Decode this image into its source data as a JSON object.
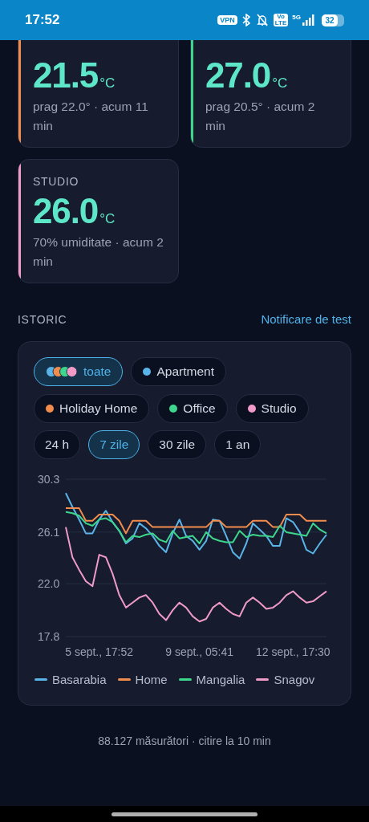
{
  "status_bar": {
    "time": "17:52",
    "vpn": "VPN",
    "volte": [
      "Vo",
      "LTE"
    ],
    "network": "5G",
    "battery": "32"
  },
  "sensor_cards": [
    {
      "value": "21.5",
      "unit": "°C",
      "detail": "prag 22.0° · acum 11 min",
      "color": "#f28c4c"
    },
    {
      "value": "27.0",
      "unit": "°C",
      "detail": "prag 20.5° · acum 2 min",
      "color": "#3dd68c"
    },
    {
      "label": "STUDIO",
      "value": "26.0",
      "unit": "°C",
      "detail": "70% umiditate · acum 2 min",
      "color": "#f09ac8"
    }
  ],
  "history": {
    "title": "ISTORIC",
    "action": "Notificare de test",
    "sensor_filters": [
      {
        "label": "toate",
        "kind": "all",
        "selected": true
      },
      {
        "label": "Apartment",
        "kind": "single",
        "color": "#5ab4e8",
        "selected": false
      },
      {
        "label": "Holiday Home",
        "kind": "single",
        "color": "#f28c4c",
        "selected": false
      },
      {
        "label": "Office",
        "kind": "single",
        "color": "#3dd68c",
        "selected": false
      },
      {
        "label": "Studio",
        "kind": "single",
        "color": "#f09ac8",
        "selected": false
      }
    ],
    "ranges": [
      {
        "label": "24 h",
        "selected": false
      },
      {
        "label": "7 zile",
        "selected": true
      },
      {
        "label": "30 zile",
        "selected": false
      },
      {
        "label": "1 an",
        "selected": false
      }
    ],
    "chart_data": {
      "type": "line",
      "categories": [
        null,
        null,
        null,
        null,
        null,
        "5 sept., 17:52",
        null,
        null,
        null,
        null,
        null,
        null,
        null,
        null,
        null,
        null,
        null,
        null,
        null,
        null,
        "9 sept., 05:41",
        null,
        null,
        null,
        null,
        null,
        null,
        null,
        null,
        null,
        null,
        null,
        null,
        null,
        "12 sept., 17:30",
        null,
        null,
        null,
        null,
        null
      ],
      "ylim": [
        17.8,
        30.3
      ],
      "yticks": [
        17.8,
        {
          "value": 22,
          "label": "22.0"
        },
        26.1,
        30.3
      ],
      "series": [
        {
          "name": "Basarabia",
          "color": "#5ab4e8",
          "values": [
            29.2,
            28.1,
            27.1,
            26.0,
            26.0,
            27.1,
            27.8,
            26.9,
            26.2,
            25.2,
            25.6,
            26.8,
            26.4,
            25.8,
            25.0,
            24.5,
            26.0,
            27.1,
            25.8,
            25.4,
            24.7,
            25.4,
            27.1,
            27.0,
            25.8,
            24.5,
            24.0,
            25.2,
            26.8,
            26.3,
            25.8,
            25.0,
            25.0,
            27.2,
            26.9,
            26.1,
            24.7,
            24.4,
            25.2,
            25.9
          ]
        },
        {
          "name": "Home",
          "color": "#f28c4c",
          "values": [
            28.0,
            28.0,
            28.0,
            27.0,
            27.0,
            27.5,
            27.5,
            27.5,
            27.0,
            26.0,
            27.0,
            27.0,
            27.0,
            26.5,
            26.5,
            26.5,
            26.5,
            26.5,
            26.5,
            26.5,
            26.5,
            26.5,
            27.0,
            27.0,
            26.5,
            26.5,
            26.5,
            26.5,
            27.0,
            27.0,
            27.0,
            26.5,
            26.5,
            27.5,
            27.5,
            27.5,
            27.0,
            27.0,
            27.0,
            27.0
          ]
        },
        {
          "name": "Mangalia",
          "color": "#3dd68c",
          "values": [
            27.7,
            27.6,
            27.4,
            26.8,
            26.6,
            27.1,
            27.2,
            26.9,
            26.2,
            25.3,
            25.8,
            25.7,
            25.9,
            26.0,
            25.5,
            25.3,
            26.2,
            25.6,
            25.7,
            25.8,
            25.2,
            26.1,
            25.6,
            25.4,
            25.3,
            25.3,
            26.2,
            25.7,
            25.9,
            25.8,
            25.8,
            25.7,
            26.6,
            26.1,
            26.0,
            25.9,
            25.8,
            26.8,
            26.3,
            26.0
          ]
        },
        {
          "name": "Snagov",
          "color": "#f09ac8",
          "values": [
            26.5,
            24.1,
            23.1,
            22.2,
            21.8,
            24.3,
            24.1,
            22.8,
            21.1,
            20.1,
            20.5,
            20.9,
            21.1,
            20.5,
            19.6,
            19.1,
            19.9,
            20.5,
            20.1,
            19.4,
            19.0,
            19.2,
            20.1,
            20.5,
            20.0,
            19.6,
            19.4,
            20.5,
            20.9,
            20.5,
            20.0,
            20.1,
            20.5,
            21.1,
            21.4,
            20.9,
            20.5,
            20.6,
            21.0,
            21.4
          ]
        }
      ]
    }
  },
  "footer": "88.127 măsurători · citire la 10 min"
}
